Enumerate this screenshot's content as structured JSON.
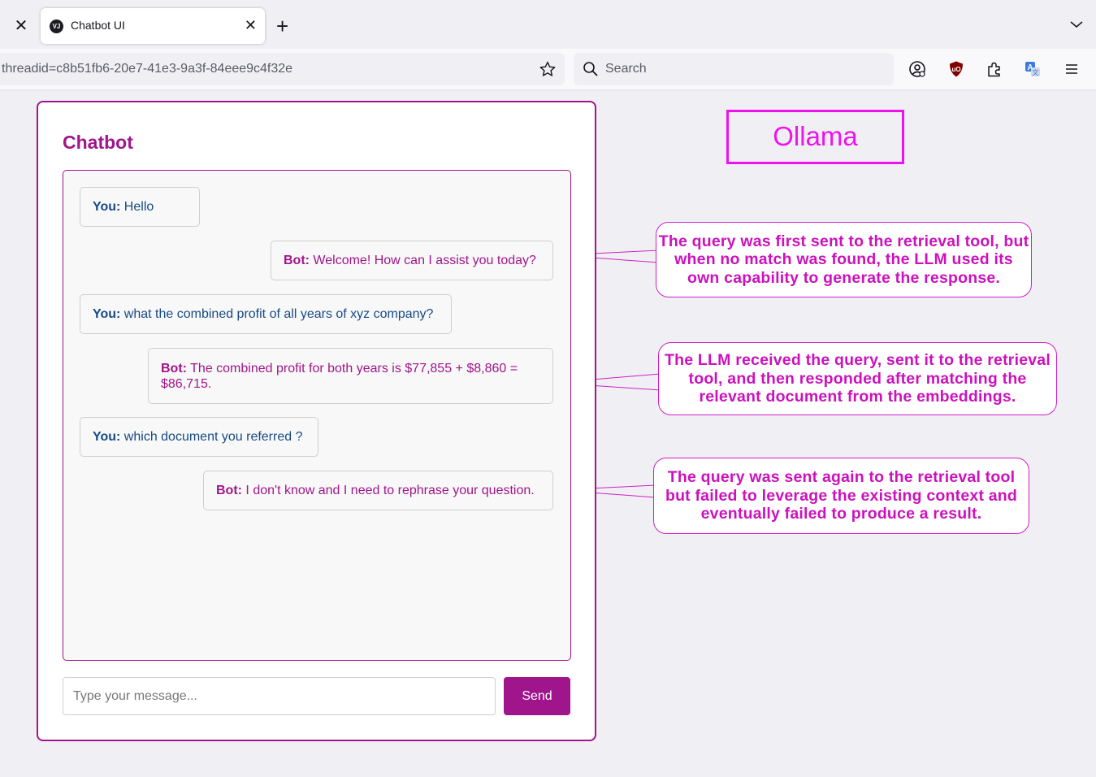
{
  "browser": {
    "tab_title": "Chatbot UI",
    "tab_favicon_text": "VJ",
    "url_text": "threadid=c8b51fb6-20e7-41e3-9a3f-84eee9c4f32e",
    "search_placeholder": "Search"
  },
  "chat": {
    "title": "Chatbot",
    "messages": [
      {
        "speaker": "You:",
        "text": " Hello",
        "role": "user"
      },
      {
        "speaker": "Bot:",
        "text": " Welcome! How can I assist you today?",
        "role": "bot"
      },
      {
        "speaker": "You:",
        "text": " what the combined profit of all years of xyz company?",
        "role": "user"
      },
      {
        "speaker": "Bot:",
        "text": " The combined profit for both years is $77,855 + $8,860 = $86,715.",
        "role": "bot"
      },
      {
        "speaker": "You:",
        "text": " which document you referred ?",
        "role": "user"
      },
      {
        "speaker": "Bot:",
        "text": " I don't know and I need to rephrase your question.",
        "role": "bot"
      }
    ],
    "input_placeholder": "Type your message...",
    "send_label": "Send"
  },
  "annotations": {
    "ollama_label": "Ollama",
    "callouts": [
      "The query was first sent to the retrieval tool, but when no match was found, the LLM used its own capability to generate the response.",
      "The LLM received the query, sent it to the retrieval tool, and then responded after matching the relevant document from the embeddings.",
      "The query was sent again to the retrieval tool but failed to leverage the existing context and eventually failed to produce a result."
    ]
  },
  "colors": {
    "accent": "#a0158c",
    "user_text": "#174a86",
    "annotation": "#ee13ee"
  }
}
